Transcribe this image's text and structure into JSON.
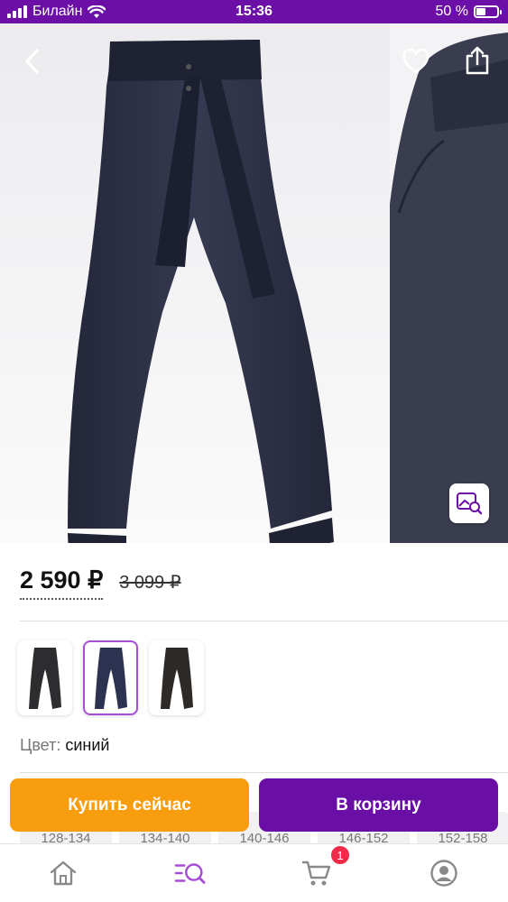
{
  "status_bar": {
    "carrier": "Билайн",
    "time": "15:36",
    "battery_text": "50 %",
    "battery_level": 0.5
  },
  "gallery": {
    "back_icon": "chevron-left-icon",
    "favorite_icon": "heart-outline-icon",
    "share_icon": "share-icon",
    "zoom_icon": "image-search-icon",
    "product_color": "#2c2f3e"
  },
  "price": {
    "current": "2 590 ₽",
    "old": "3 099 ₽"
  },
  "colors": {
    "label": "Цвет:",
    "selected": "синий",
    "swatches": [
      {
        "color": "#2d2d30",
        "selected": false
      },
      {
        "color": "#2b3350",
        "selected": true
      },
      {
        "color": "#2e2a28",
        "selected": false
      }
    ]
  },
  "sizes": [
    "128-134",
    "134-140",
    "140-146",
    "146-152",
    "152-158"
  ],
  "actions": {
    "buy_now": "Купить сейчас",
    "add_to_cart": "В корзину"
  },
  "tabbar": {
    "items": [
      "home-icon",
      "catalog-search-icon",
      "cart-icon",
      "profile-icon"
    ],
    "cart_badge": "1"
  },
  "theme": {
    "accent": "#6a0fa6",
    "orange": "#f79d0e",
    "badge": "#ef2b4a"
  }
}
